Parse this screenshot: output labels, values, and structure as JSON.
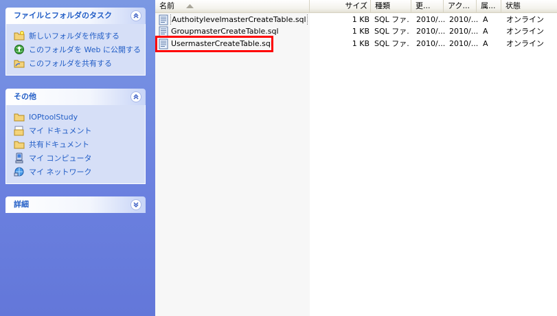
{
  "taskpane": {
    "panels": [
      {
        "title": "ファイルとフォルダのタスク",
        "items": [
          {
            "label": "新しいフォルダを作成する",
            "icon": "new-folder-icon"
          },
          {
            "label": "このフォルダを Web に公開する",
            "icon": "web-publish-icon"
          },
          {
            "label": "このフォルダを共有する",
            "icon": "share-folder-icon"
          }
        ]
      },
      {
        "title": "その他",
        "items": [
          {
            "label": "IOPtoolStudy",
            "icon": "folder-icon"
          },
          {
            "label": "マイ ドキュメント",
            "icon": "my-documents-icon"
          },
          {
            "label": "共有ドキュメント",
            "icon": "folder-icon"
          },
          {
            "label": "マイ コンピュータ",
            "icon": "my-computer-icon"
          },
          {
            "label": "マイ ネットワーク",
            "icon": "my-network-icon"
          }
        ]
      },
      {
        "title": "詳細",
        "items": []
      }
    ]
  },
  "filelist": {
    "columns": {
      "name": "名前",
      "size": "サイズ",
      "type": "種類",
      "updated": "更...",
      "accessed": "アク...",
      "attributes": "属...",
      "status": "状態"
    },
    "files": [
      {
        "name": "AuthoitylevelmasterCreateTable.sql",
        "size": "1 KB",
        "type": "SQL ファ...",
        "updated": "2010/...",
        "accessed": "2010/...",
        "attributes": "A",
        "status": "オンライン"
      },
      {
        "name": "GroupmasterCreateTable.sql",
        "size": "1 KB",
        "type": "SQL ファ...",
        "updated": "2010/...",
        "accessed": "2010/...",
        "attributes": "A",
        "status": "オンライン"
      },
      {
        "name": "UsermasterCreateTable.sql",
        "size": "1 KB",
        "type": "SQL ファ...",
        "updated": "2010/...",
        "accessed": "2010/...",
        "attributes": "A",
        "status": "オンライン"
      }
    ]
  },
  "colors": {
    "taskpane_bg": "#6c82e0",
    "panel_title": "#215dc6",
    "highlight": "#ff0000"
  }
}
